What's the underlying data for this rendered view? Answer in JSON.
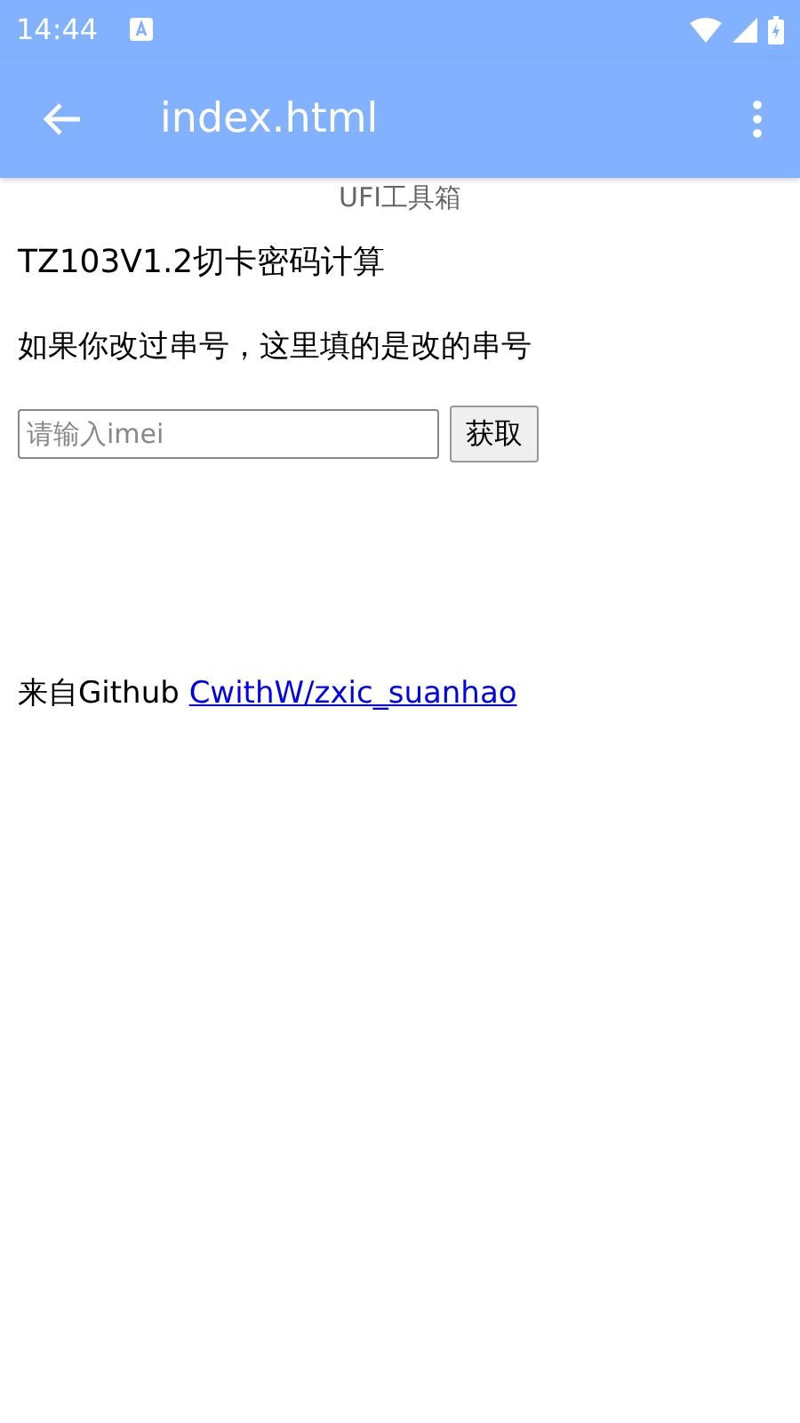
{
  "status_bar": {
    "time": "14:44"
  },
  "app_bar": {
    "title": "index.html"
  },
  "page": {
    "header": "UFI工具箱",
    "heading": "TZ103V1.2切卡密码计算",
    "note": "如果你改过串号，这里填的是改的串号",
    "imei_field": {
      "placeholder": "请输入imei"
    },
    "button": "获取",
    "credit": {
      "text": "来自Github",
      "link": "CwithW/zxic_suanhao"
    }
  }
}
